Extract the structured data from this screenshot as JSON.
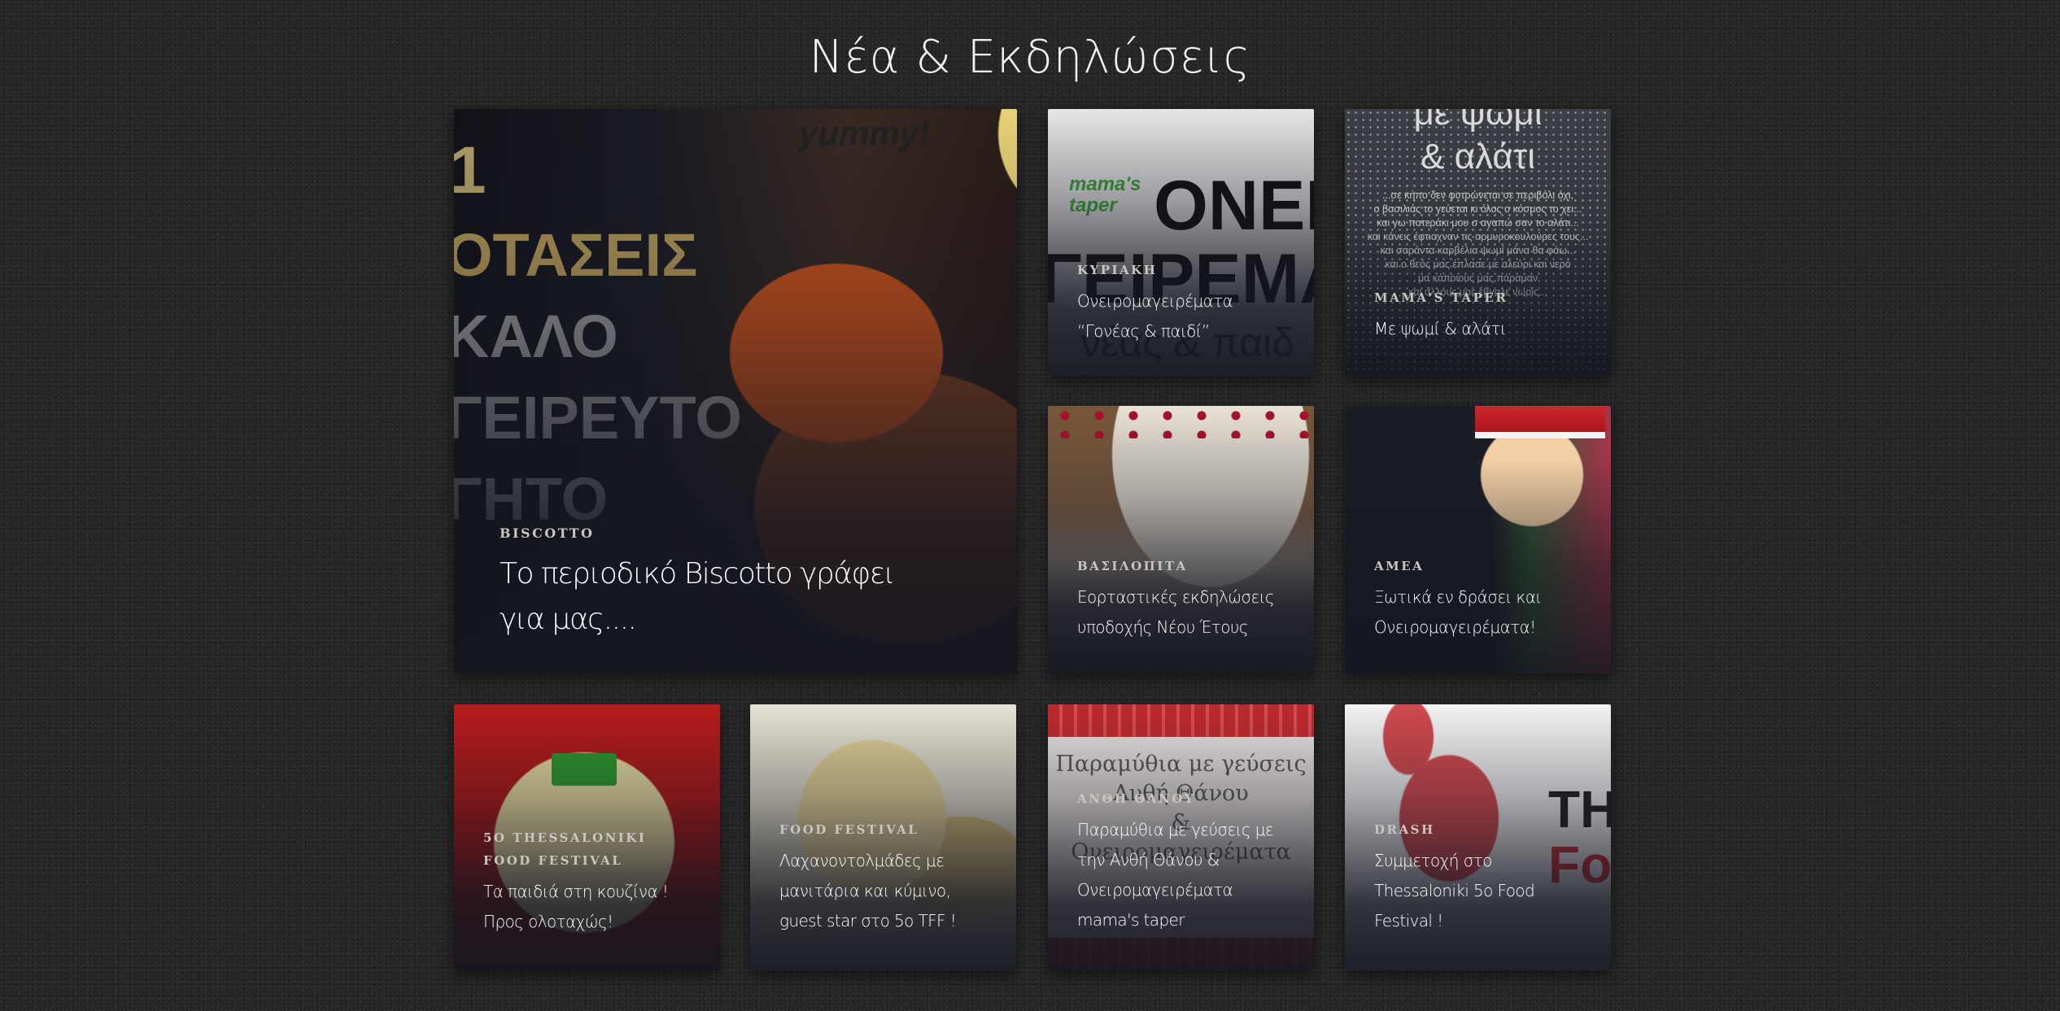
{
  "page": {
    "title": "Νέα & Εκδηλώσεις"
  },
  "cards": [
    {
      "id": "biscotto",
      "category": "BISCOTTO",
      "title": "Το περιοδικό Biscotto γράφει για μας....",
      "image_text": {
        "big_letters": [
          "1",
          "ΟΤΑΣΕΙΣ",
          "ΚΑΛΟ",
          "ΓΕΙΡΕΥΤΟ",
          "ΓΗΤΟ"
        ],
        "badge": "yummy!"
      }
    },
    {
      "id": "oneiro-goneas",
      "category": "ΚΥΡΙΑΚΗ",
      "title": "Ονειρομαγειρέματα “Γονέας & παιδί”",
      "image_text": {
        "logo": "mama's taper",
        "big": "ΟΝΕΙ",
        "big2": "ΓΕΙΡΕΜΑ",
        "small": "νέας & παιδ"
      }
    },
    {
      "id": "psomi-alati",
      "category": "MAMA'S TAPER",
      "title": "Με ψωμί & αλάτι",
      "image_text": {
        "heading": [
          "με ψωμί",
          "& αλάτι"
        ],
        "lines": [
          "...σε κήπο δεν φυτρώνεται σε περιβόλι όχι,",
          "ο βασιλιάς το γεύεται κι όλος ο κόσμος το χει...",
          "και γω πατεράκι μου σ αγαπώ σαν το αλάτι...",
          "και κάνεις έφτιαχναν τις αρμυροκουλούρες τους...",
          "και σαράντα καρβέλια ψωμί μάνα θα φάω...",
          "και ο θεός μας έπλασε με αλεύρι και νερό",
          "μα κάποιους μας πάραμαν",
          "και άλλους μας έβγαλε νωρίς..."
        ]
      }
    },
    {
      "id": "vasilopita",
      "category": "ΒΑΣΙΛΟΠΙΤΑ",
      "title": "Εορταστικές εκδηλώσεις υποδοχής Νέου Έτους"
    },
    {
      "id": "amea",
      "category": "ΑΜΕΑ",
      "title": "Ξωτικά εν δράσει και Ονειρομαγειρέματα!"
    },
    {
      "id": "snowman",
      "category": "5Ο THESSALONIKI FOOD FESTIVAL",
      "title": "Τα παιδιά στη κουζίνα ! Προς ολοταχώς!"
    },
    {
      "id": "lahano",
      "category": "FOOD FESTIVAL",
      "title": "Λαχανοντολμάδες με μανιτάρια και κύμινο, guest star στο 5ο TFF !"
    },
    {
      "id": "paramythia",
      "category": "ΑΝΘΗ ΘΑΝΟΥ",
      "title": "Παραμύθια με γεύσεις με την Ανθή Θάνου & Ονειρομαγειρέματα mama's taper",
      "image_text": {
        "lines": [
          "Παραμύθια με γεύσεις",
          "Ανθή Θάνου",
          "&",
          "Ονειρομαγειρέματα"
        ]
      }
    },
    {
      "id": "drash",
      "category": "DRASH",
      "title": "Συμμετοχή στο Thessaloniki 5o Food Festival !",
      "image_text": {
        "big": "TH",
        "big2": "Fo"
      }
    }
  ]
}
